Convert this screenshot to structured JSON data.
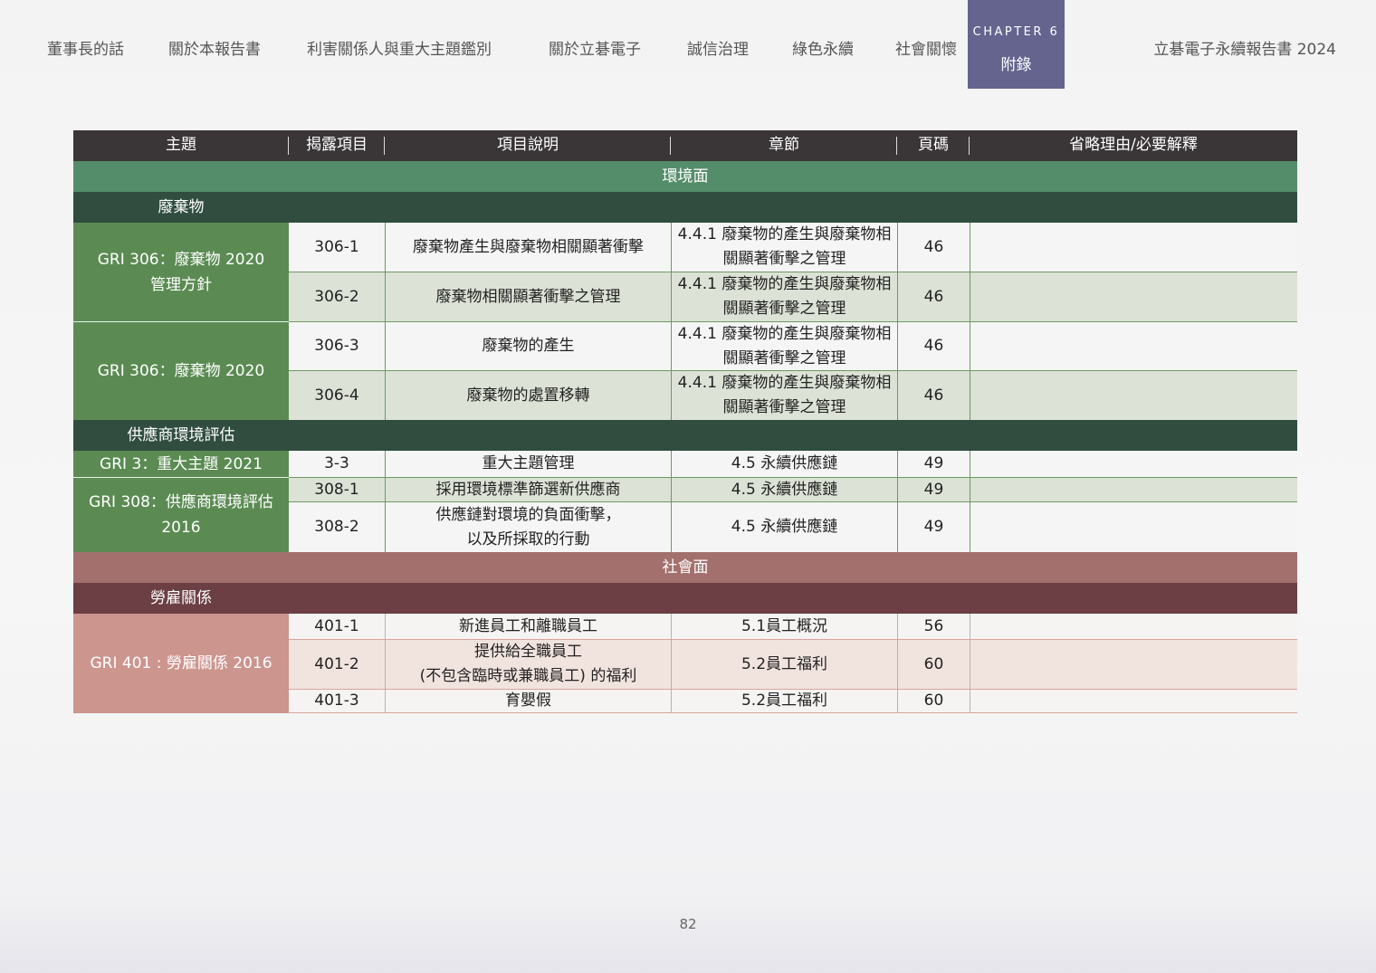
{
  "nav": {
    "items": [
      "董事長的話",
      "關於本報告書",
      "利害關係人與重大主題鑑別",
      "關於立碁電子",
      "誠信治理",
      "綠色永續",
      "社會關懷"
    ],
    "chapter_label": "CHAPTER 6",
    "chapter_name": "附錄",
    "report_title": "立碁電子永續報告書 2024"
  },
  "colors": {
    "chapter_tab": "#64648f",
    "header": "#3a3536",
    "environment_band": "#548d69",
    "environment_subtopic": "#304d40",
    "environment_group": "#5b8b53",
    "social_band": "#a3706d",
    "social_subtopic": "#6b3f44",
    "social_group": "#cc958e"
  },
  "table": {
    "headers": [
      "主題",
      "揭露項目",
      "項目說明",
      "章節",
      "頁碼",
      "省略理由/必要解釋"
    ],
    "environment": {
      "label": "環境面",
      "waste": {
        "label": "廢棄物",
        "groups": [
          {
            "topic": "GRI 306：廢棄物 2020\n管理方針",
            "rows": [
              {
                "code": "306-1",
                "desc": "廢棄物產生與廢棄物相關顯著衝擊",
                "section": "4.4.1 廢棄物的產生與廢棄物相關顯著衝擊之管理",
                "page": "46",
                "note": ""
              },
              {
                "code": "306-2",
                "desc": "廢棄物相關顯著衝擊之管理",
                "section": "4.4.1 廢棄物的產生與廢棄物相關顯著衝擊之管理",
                "page": "46",
                "note": ""
              }
            ]
          },
          {
            "topic": "GRI 306：廢棄物 2020",
            "rows": [
              {
                "code": "306-3",
                "desc": "廢棄物的產生",
                "section": "4.4.1 廢棄物的產生與廢棄物相關顯著衝擊之管理",
                "page": "46",
                "note": ""
              },
              {
                "code": "306-4",
                "desc": "廢棄物的處置移轉",
                "section": "4.4.1 廢棄物的產生與廢棄物相關顯著衝擊之管理",
                "page": "46",
                "note": ""
              }
            ]
          }
        ]
      },
      "supplier": {
        "label": "供應商環境評估",
        "groups": [
          {
            "topic": "GRI 3：重大主題 2021",
            "rows": [
              {
                "code": "3-3",
                "desc": "重大主題管理",
                "section": "4.5 永續供應鏈",
                "page": "49",
                "note": ""
              }
            ]
          },
          {
            "topic": "GRI 308：供應商環境評估\n2016",
            "rows": [
              {
                "code": "308-1",
                "desc": "採用環境標準篩選新供應商",
                "section": "4.5 永續供應鏈",
                "page": "49",
                "note": ""
              },
              {
                "code": "308-2",
                "desc": "供應鏈對環境的負面衝擊，\n以及所採取的行動",
                "section": "4.5 永續供應鏈",
                "page": "49",
                "note": ""
              }
            ]
          }
        ]
      }
    },
    "social": {
      "label": "社會面",
      "labor": {
        "label": "勞雇關係",
        "groups": [
          {
            "topic": "GRI 401 : 勞雇關係 2016",
            "rows": [
              {
                "code": "401-1",
                "desc": "新進員工和離職員工",
                "section": "5.1員工概況",
                "page": "56",
                "note": ""
              },
              {
                "code": "401-2",
                "desc": "提供給全職員工\n(不包含臨時或兼職員工) 的福利",
                "section": "5.2員工福利",
                "page": "60",
                "note": ""
              },
              {
                "code": "401-3",
                "desc": "育嬰假",
                "section": "5.2員工福利",
                "page": "60",
                "note": ""
              }
            ]
          }
        ]
      }
    }
  },
  "page_number": "82"
}
